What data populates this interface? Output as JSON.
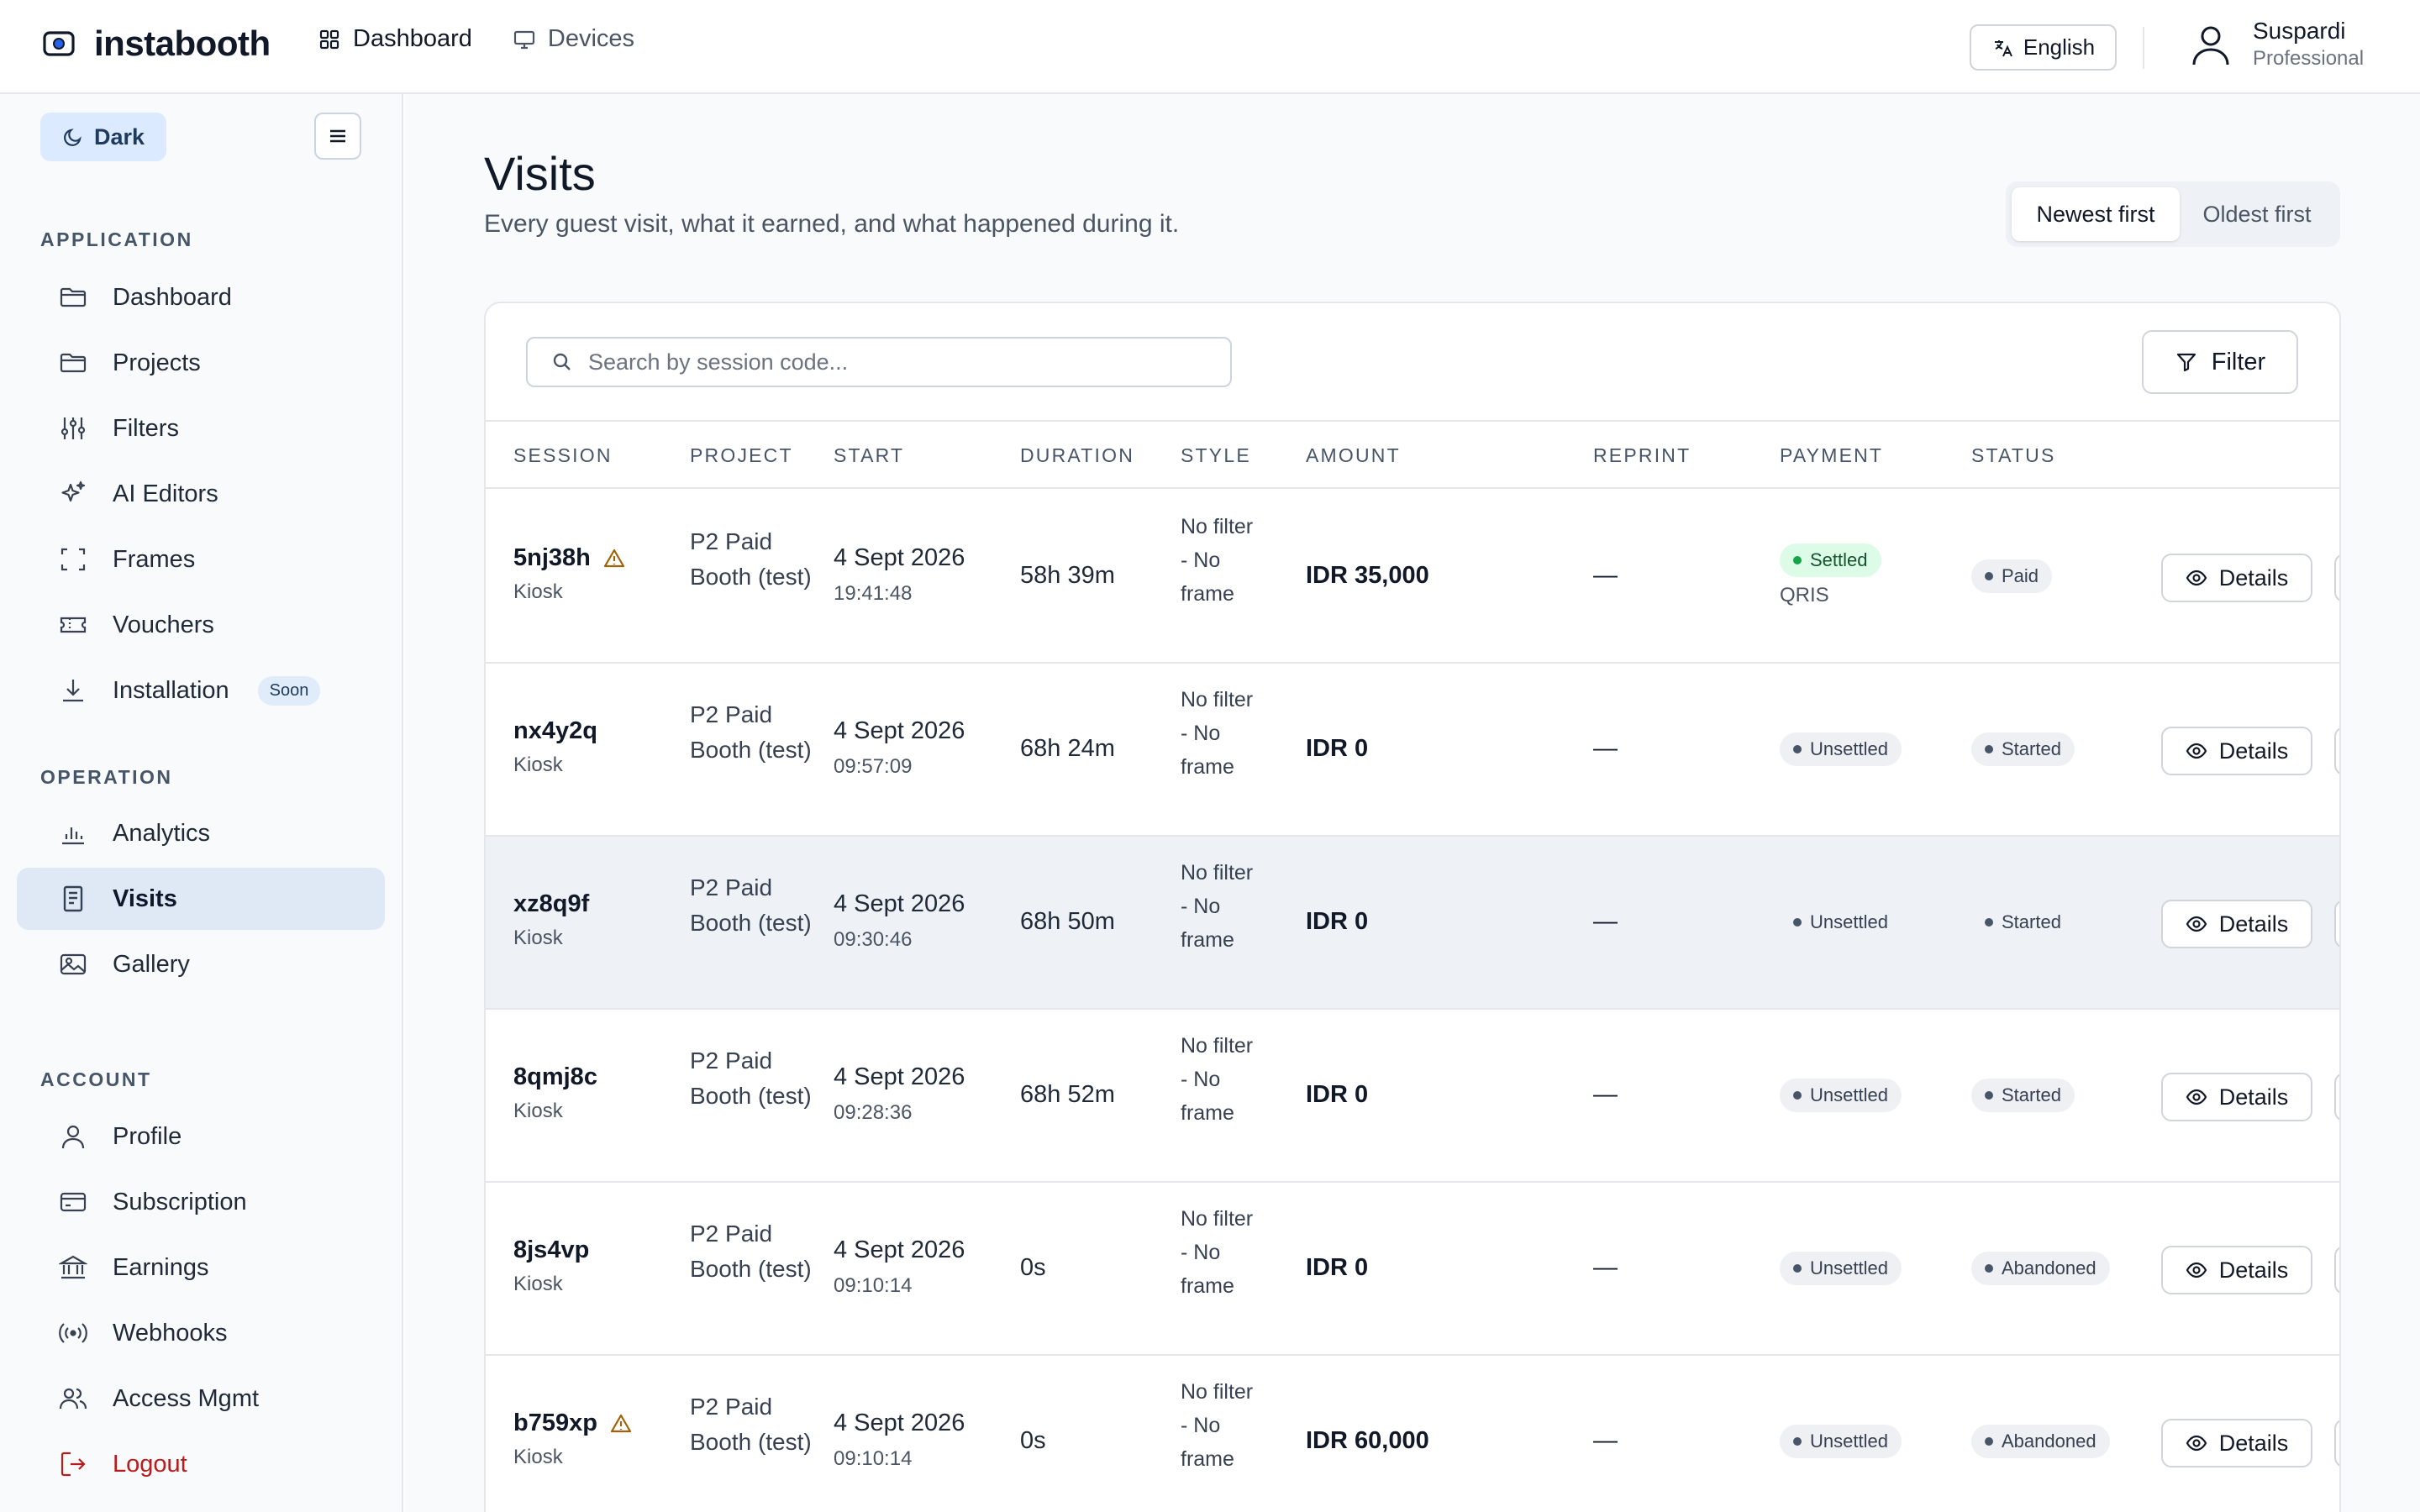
{
  "app": {
    "name": "instabooth"
  },
  "topnav": {
    "items": [
      {
        "label": "Dashboard"
      },
      {
        "label": "Devices"
      }
    ]
  },
  "language": {
    "label": "English"
  },
  "user": {
    "name": "Suspardi",
    "role": "Professional"
  },
  "sidebar": {
    "theme_label": "Dark",
    "sections": {
      "application": "APPLICATION",
      "operation": "OPERATION",
      "account": "ACCOUNT"
    },
    "application_items": [
      {
        "label": "Dashboard",
        "icon": "folder-icon"
      },
      {
        "label": "Projects",
        "icon": "folder-icon"
      },
      {
        "label": "Filters",
        "icon": "sliders-icon"
      },
      {
        "label": "AI Editors",
        "icon": "sparkle-icon"
      },
      {
        "label": "Frames",
        "icon": "frame-corners-icon"
      },
      {
        "label": "Vouchers",
        "icon": "ticket-icon"
      },
      {
        "label": "Installation",
        "icon": "download-icon",
        "badge": "Soon"
      }
    ],
    "operation_items": [
      {
        "label": "Analytics",
        "icon": "bar-chart-icon"
      },
      {
        "label": "Visits",
        "icon": "document-list-icon",
        "active": true
      },
      {
        "label": "Gallery",
        "icon": "image-icon"
      }
    ],
    "account_items": [
      {
        "label": "Profile",
        "icon": "user-icon"
      },
      {
        "label": "Subscription",
        "icon": "credit-card-icon"
      },
      {
        "label": "Earnings",
        "icon": "bank-icon"
      },
      {
        "label": "Webhooks",
        "icon": "broadcast-icon"
      },
      {
        "label": "Access Mgmt",
        "icon": "users-icon"
      },
      {
        "label": "Logout",
        "icon": "logout-icon"
      }
    ]
  },
  "page": {
    "title": "Visits",
    "subtitle": "Every guest visit, what it earned, and what happened during it.",
    "sort": {
      "newest": "Newest first",
      "oldest": "Oldest first",
      "selected": "Newest first"
    },
    "search_placeholder": "Search by session code...",
    "filter_label": "Filter"
  },
  "table": {
    "columns": [
      "SESSION",
      "PROJECT",
      "START",
      "DURATION",
      "STYLE",
      "AMOUNT",
      "REPRINT",
      "PAYMENT",
      "STATUS"
    ],
    "details_label": "Details",
    "rows": [
      {
        "session": "5nj38h",
        "warning": true,
        "source": "Kiosk",
        "project": "P2 Paid Booth (test)",
        "date": "4 Sept 2026",
        "time": "19:41:48",
        "duration": "58h 39m",
        "style": "No filter - No frame",
        "amount": "IDR 35,000",
        "reprint": "—",
        "payment": "Settled",
        "payment_method": "QRIS",
        "status": "Paid"
      },
      {
        "session": "nx4y2q",
        "warning": false,
        "source": "Kiosk",
        "project": "P2 Paid Booth (test)",
        "date": "4 Sept 2026",
        "time": "09:57:09",
        "duration": "68h 24m",
        "style": "No filter - No frame",
        "amount": "IDR 0",
        "reprint": "—",
        "payment": "Unsettled",
        "payment_method": "",
        "status": "Started"
      },
      {
        "session": "xz8q9f",
        "warning": false,
        "source": "Kiosk",
        "project": "P2 Paid Booth (test)",
        "date": "4 Sept 2026",
        "time": "09:30:46",
        "duration": "68h 50m",
        "style": "No filter - No frame",
        "amount": "IDR 0",
        "reprint": "—",
        "payment": "Unsettled",
        "payment_method": "",
        "status": "Started"
      },
      {
        "session": "8qmj8c",
        "warning": false,
        "source": "Kiosk",
        "project": "P2 Paid Booth (test)",
        "date": "4 Sept 2026",
        "time": "09:28:36",
        "duration": "68h 52m",
        "style": "No filter - No frame",
        "amount": "IDR 0",
        "reprint": "—",
        "payment": "Unsettled",
        "payment_method": "",
        "status": "Started"
      },
      {
        "session": "8js4vp",
        "warning": false,
        "source": "Kiosk",
        "project": "P2 Paid Booth (test)",
        "date": "4 Sept 2026",
        "time": "09:10:14",
        "duration": "0s",
        "style": "No filter - No frame",
        "amount": "IDR 0",
        "reprint": "—",
        "payment": "Unsettled",
        "payment_method": "",
        "status": "Abandoned"
      },
      {
        "session": "b759xp",
        "warning": true,
        "source": "Kiosk",
        "project": "P2 Paid Booth (test)",
        "date": "4 Sept 2026",
        "time": "09:10:14",
        "duration": "0s",
        "style": "No filter - No frame",
        "amount": "IDR 60,000",
        "reprint": "—",
        "payment": "Unsettled",
        "payment_method": "",
        "status": "Abandoned"
      }
    ]
  }
}
